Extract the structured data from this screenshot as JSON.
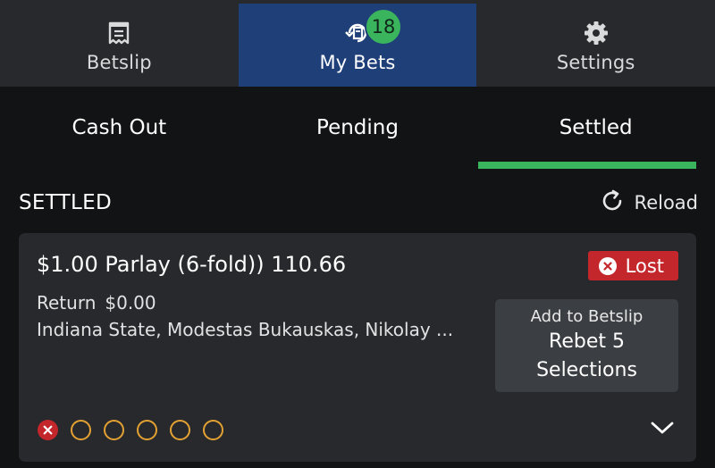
{
  "topnav": {
    "items": [
      {
        "label": "Betslip",
        "icon": "receipt-icon"
      },
      {
        "label": "My Bets",
        "icon": "bets-history-icon",
        "badge": "18"
      },
      {
        "label": "Settings",
        "icon": "gear-icon"
      }
    ],
    "active": "My Bets"
  },
  "subtabs": {
    "items": [
      "Cash Out",
      "Pending",
      "Settled"
    ],
    "active": "Settled"
  },
  "section": {
    "title": "SETTLED",
    "reload_label": "Reload"
  },
  "bet": {
    "title": "$1.00 Parlay (6-fold)) 110.66",
    "status": "Lost",
    "return_label": "Return",
    "return_value": "$0.00",
    "selections": "Indiana State, Modestas Bukauskas, Nikolay ...",
    "rebet_top": "Add to Betslip",
    "rebet_main": "Rebet 5 Selections",
    "legs": [
      "lost",
      "pending",
      "pending",
      "pending",
      "pending",
      "pending"
    ]
  },
  "colors": {
    "accent_green": "#3bb55d",
    "active_tab_bg": "#1f3f78",
    "lost_red": "#c3272b",
    "pending_orange": "#e4a133"
  }
}
